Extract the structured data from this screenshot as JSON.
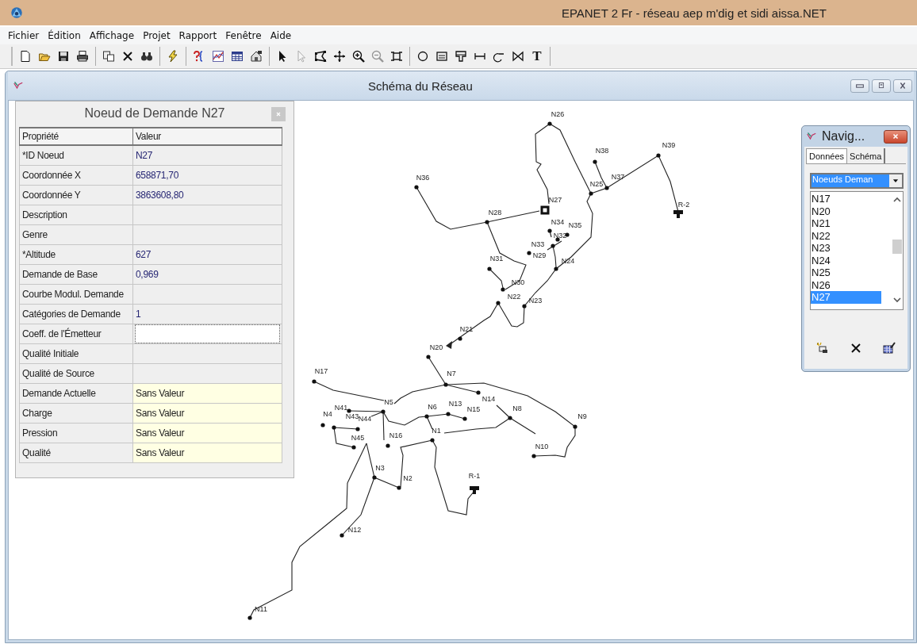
{
  "window": {
    "title": "EPANET 2 Fr - réseau aep m'dig et sidi aissa.NET"
  },
  "menu": [
    "Fichier",
    "Édition",
    "Affichage",
    "Projet",
    "Rapport",
    "Fenêtre",
    "Aide"
  ],
  "toolbar_groups": [
    [
      {
        "kind": "new",
        "disabled": false
      },
      {
        "kind": "open",
        "disabled": false
      },
      {
        "kind": "save",
        "disabled": false
      },
      {
        "kind": "print",
        "disabled": false
      }
    ],
    [
      {
        "kind": "copy",
        "disabled": false
      },
      {
        "kind": "delete",
        "disabled": false
      },
      {
        "kind": "find",
        "disabled": false
      }
    ],
    [
      {
        "kind": "run",
        "disabled": false
      }
    ],
    [
      {
        "kind": "query",
        "disabled": false
      },
      {
        "kind": "graph",
        "disabled": false
      },
      {
        "kind": "table",
        "disabled": false
      },
      {
        "kind": "options",
        "disabled": false
      }
    ],
    [
      {
        "kind": "select",
        "disabled": false
      },
      {
        "kind": "vertex",
        "disabled": true
      },
      {
        "kind": "region",
        "disabled": false
      },
      {
        "kind": "pan",
        "disabled": false
      },
      {
        "kind": "zoomin",
        "disabled": false
      },
      {
        "kind": "zoomout",
        "disabled": true
      },
      {
        "kind": "extent",
        "disabled": false
      }
    ],
    [
      {
        "kind": "junction",
        "disabled": false
      },
      {
        "kind": "reservoir",
        "disabled": false
      },
      {
        "kind": "tank",
        "disabled": false
      },
      {
        "kind": "pipe",
        "disabled": false
      },
      {
        "kind": "pump",
        "disabled": false
      },
      {
        "kind": "valve",
        "disabled": false
      },
      {
        "kind": "label",
        "glyph": "T",
        "disabled": false
      }
    ]
  ],
  "map_window": {
    "title": "Schéma du Réseau"
  },
  "property_panel": {
    "title": "Noeud de Demande N27",
    "columns": [
      "Propriété",
      "Valeur"
    ],
    "rows": [
      {
        "property": "*ID Noeud",
        "value": "N27",
        "kind": "input"
      },
      {
        "property": "Coordonnée X",
        "value": "658871,70",
        "kind": "input"
      },
      {
        "property": "Coordonnée Y",
        "value": "3863608,80",
        "kind": "input"
      },
      {
        "property": "Description",
        "kind": "input"
      },
      {
        "property": "Genre",
        "kind": "input"
      },
      {
        "property": "*Altitude",
        "value": "627",
        "kind": "input"
      },
      {
        "property": "Demande de Base",
        "value": "0,969",
        "kind": "input"
      },
      {
        "property": "Courbe Modul. Demande",
        "kind": "input"
      },
      {
        "property": "Catégories de Demande",
        "value": "1",
        "kind": "input"
      },
      {
        "property": "Coeff. de l'Émetteur",
        "kind": "editing"
      },
      {
        "property": "Qualité Initiale",
        "kind": "input"
      },
      {
        "property": "Qualité de Source",
        "kind": "input"
      },
      {
        "property": "Demande Actuelle",
        "value": "Sans Valeur",
        "kind": "computed"
      },
      {
        "property": "Charge",
        "value": "Sans Valeur",
        "kind": "computed"
      },
      {
        "property": "Pression",
        "value": "Sans Valeur",
        "kind": "computed"
      },
      {
        "property": "Qualité",
        "value": "Sans Valeur",
        "kind": "computed"
      }
    ]
  },
  "network": {
    "nodes": [
      {
        "label": "N26",
        "kind": "junction",
        "selected": false
      },
      {
        "label": "N39",
        "kind": "junction",
        "selected": false
      },
      {
        "label": "N38",
        "kind": "junction",
        "selected": false
      },
      {
        "label": "N36",
        "kind": "junction",
        "selected": false
      },
      {
        "label": "N37",
        "kind": "junction",
        "selected": false
      },
      {
        "label": "N25",
        "kind": "junction",
        "selected": false
      },
      {
        "label": "R-2",
        "kind": "reservoir",
        "selected": false
      },
      {
        "label": "N27",
        "kind": "junction",
        "selected": true
      },
      {
        "label": "N28",
        "kind": "junction",
        "selected": false
      },
      {
        "label": "N34",
        "kind": "junction",
        "selected": false
      },
      {
        "label": "N35",
        "kind": "junction",
        "selected": false
      },
      {
        "label": "N32",
        "kind": "junction",
        "selected": false
      },
      {
        "label": "N33",
        "kind": "junction",
        "selected": false
      },
      {
        "label": "N29",
        "kind": "junction",
        "selected": false
      },
      {
        "label": "N31",
        "kind": "junction",
        "selected": false
      },
      {
        "label": "N24",
        "kind": "junction",
        "selected": false
      },
      {
        "label": "N30",
        "kind": "junction",
        "selected": false
      },
      {
        "label": "N22",
        "kind": "junction",
        "selected": false
      },
      {
        "label": "N23",
        "kind": "junction",
        "selected": false
      },
      {
        "label": "N21",
        "kind": "junction",
        "selected": false
      },
      {
        "label": "N20",
        "kind": "junction",
        "selected": false
      },
      {
        "label": "N17",
        "kind": "junction",
        "selected": false
      },
      {
        "label": "N7",
        "kind": "junction",
        "selected": false
      },
      {
        "label": "N41",
        "kind": "junction",
        "selected": false
      },
      {
        "label": "N4",
        "kind": "junction",
        "selected": false
      },
      {
        "label": "N43",
        "kind": "junction",
        "selected": false
      },
      {
        "label": "N44",
        "kind": "junction",
        "selected": false
      },
      {
        "label": "N5",
        "kind": "junction",
        "selected": false
      },
      {
        "label": "N6",
        "kind": "junction",
        "selected": false
      },
      {
        "label": "N13",
        "kind": "junction",
        "selected": false
      },
      {
        "label": "N15",
        "kind": "junction",
        "selected": false
      },
      {
        "label": "N14",
        "kind": "junction",
        "selected": false
      },
      {
        "label": "N8",
        "kind": "junction",
        "selected": false
      },
      {
        "label": "N9",
        "kind": "junction",
        "selected": false
      },
      {
        "label": "N45",
        "kind": "junction",
        "selected": false
      },
      {
        "label": "N16",
        "kind": "junction",
        "selected": false
      },
      {
        "label": "N1",
        "kind": "junction",
        "selected": false
      },
      {
        "label": "N10",
        "kind": "junction",
        "selected": false
      },
      {
        "label": "N3",
        "kind": "junction",
        "selected": false
      },
      {
        "label": "R-1",
        "kind": "reservoir",
        "selected": false
      },
      {
        "label": "N2",
        "kind": "junction",
        "selected": false
      },
      {
        "label": "N12",
        "kind": "junction",
        "selected": false
      },
      {
        "label": "N11",
        "kind": "junction",
        "selected": false
      }
    ]
  },
  "navigator": {
    "title": "Navig...",
    "tabs": [
      {
        "label": "Données",
        "selected": true
      },
      {
        "label": "Schéma",
        "selected": false
      }
    ],
    "category": "Noeuds Deman",
    "items": [
      {
        "label": "N17",
        "selected": false
      },
      {
        "label": "N20",
        "selected": false
      },
      {
        "label": "N21",
        "selected": false
      },
      {
        "label": "N22",
        "selected": false
      },
      {
        "label": "N23",
        "selected": false
      },
      {
        "label": "N24",
        "selected": false
      },
      {
        "label": "N25",
        "selected": false
      },
      {
        "label": "N26",
        "selected": false
      },
      {
        "label": "N27",
        "selected": true
      }
    ]
  }
}
